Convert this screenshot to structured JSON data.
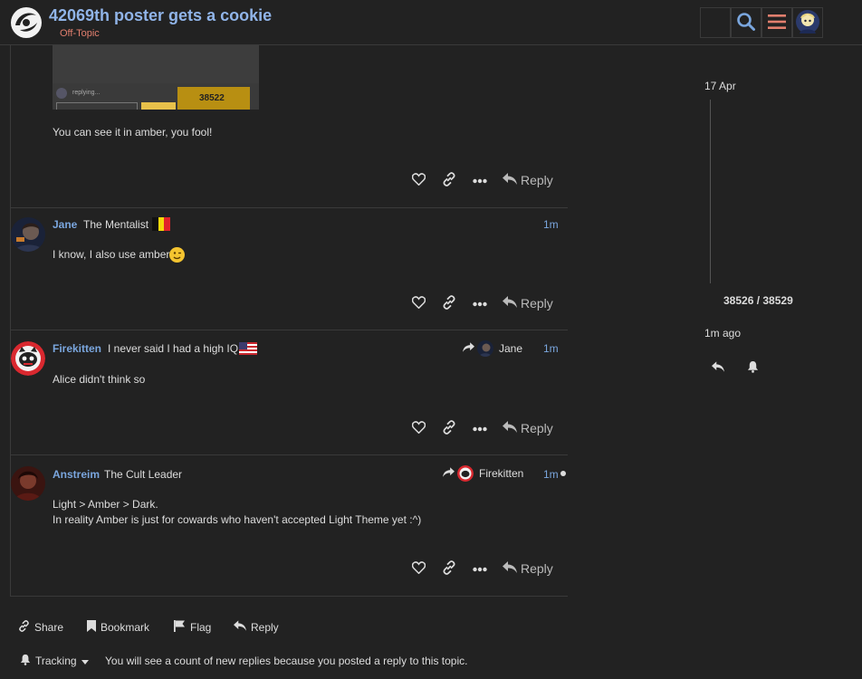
{
  "header": {
    "title": "42069th poster gets a cookie",
    "category": "Off-Topic"
  },
  "embedded_image": {
    "replying_text": "replying...",
    "counter": "38522"
  },
  "posts": [
    {
      "body": [
        "You can see it in amber, you fool!"
      ],
      "reply_label": "Reply"
    },
    {
      "username": "Jane",
      "title": "The Mentalist",
      "flag": "belgium",
      "time": "1m",
      "body": [
        "I know, I also use amber"
      ],
      "reply_label": "Reply"
    },
    {
      "username": "Firekitten",
      "title": "I never said I had a high IQ",
      "flag": "usa",
      "time": "1m",
      "reply_to": "Jane",
      "body": [
        "Alice didn't think so"
      ],
      "reply_label": "Reply"
    },
    {
      "username": "Anstreim",
      "title": "The Cult Leader",
      "time": "1m",
      "reply_to": "Firekitten",
      "body": [
        "Light > Amber > Dark.",
        "In reality Amber is just for cowards who haven't accepted Light Theme yet :^)"
      ],
      "reply_label": "Reply"
    }
  ],
  "timeline": {
    "date": "17 Apr",
    "count": "38526 / 38529",
    "ago": "1m ago"
  },
  "footer": {
    "share": "Share",
    "bookmark": "Bookmark",
    "flag": "Flag",
    "reply": "Reply",
    "tracking": "Tracking",
    "tracking_desc": "You will see a count of new replies because you posted a reply to this topic."
  },
  "colors": {
    "background": "#222222",
    "link": "#7aa6de",
    "title": "#90b4e8",
    "category": "#e27f6e",
    "menu_icon": "#e27f6e"
  }
}
